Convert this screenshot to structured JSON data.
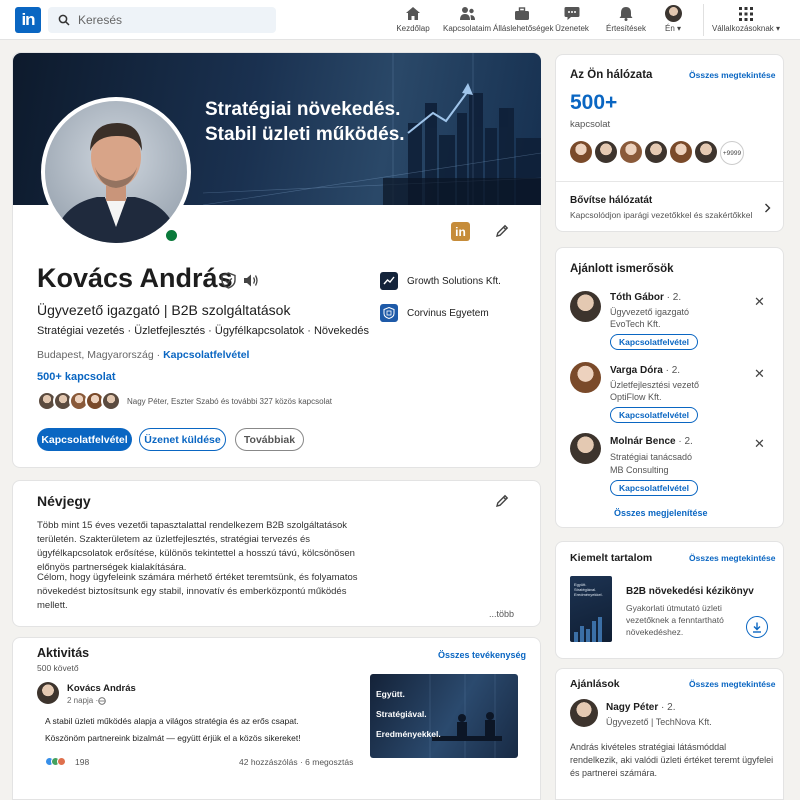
{
  "nav": {
    "search_placeholder": "Keresés",
    "items": [
      {
        "label": "Kezdőlap",
        "icon": "home-icon"
      },
      {
        "label": "Kapcsolataim",
        "icon": "network-icon"
      },
      {
        "label": "Álláslehetőségek",
        "icon": "briefcase-icon"
      },
      {
        "label": "Üzenetek",
        "icon": "message-icon"
      },
      {
        "label": "Értesítések",
        "icon": "bell-icon"
      },
      {
        "label": "Én ▾",
        "icon": "avatar"
      },
      {
        "label": "Vállalkozásoknak ▾",
        "icon": "grid-icon"
      }
    ]
  },
  "profile": {
    "banner_line1": "Stratégiai növekedés.",
    "banner_line2": "Stabil üzleti működés.",
    "name": "Kovács András",
    "headline": "Ügyvezető igazgató | B2B szolgáltatások",
    "skills": "Stratégiai vezetés · Üzletfejlesztés · Ügyfélkapcsolatok · Növekedés",
    "location": "Budapest, Magyarország",
    "contact_link": "Kapcsolatfelvétel",
    "connections": "500+ kapcsolat",
    "mutual": "Nagy Péter, Eszter Szabó és további 327 közös kapcsolat",
    "buttons": {
      "connect": "Kapcsolatfelvétel",
      "message": "Üzenet küldése",
      "more": "Továbbiak"
    },
    "orgs": [
      {
        "name": "Growth Solutions Kft."
      },
      {
        "name": "Corvinus Egyetem"
      }
    ],
    "badge_text": "in"
  },
  "about": {
    "title": "Névjegy",
    "p1": "Több mint 15 éves vezetői tapasztalattal rendelkezem B2B szolgáltatások területén. Szakterületem az üzletfejlesztés, stratégiai tervezés és ügyfélkapcsolatok erősítése, különös tekintettel a hosszú távú, kölcsönösen előnyös partnerségek kialakítására.",
    "p2": "Célom, hogy ügyfeleink számára mérhető értéket teremtsünk, és folyamatos növekedést biztosítsunk egy stabil, innovatív és emberközpontú működés mellett.",
    "more": "...több"
  },
  "activity": {
    "title": "Aktivitás",
    "followers": "500 követő",
    "all_link": "Összes tevékenység",
    "post_author": "Kovács András",
    "post_time": "2 napja · ",
    "post_line1": "A stabil üzleti működés alapja a világos stratégia és az erős csapat.",
    "post_line2": "Köszönöm partnereink bizalmát — együtt érjük el a közös sikereket!",
    "reactions": "198",
    "comments": "42 hozzászólás",
    "shares": "6 megosztás",
    "image_lines": [
      "Együtt.",
      "Stratégiával.",
      "Eredményekkel."
    ]
  },
  "network": {
    "title": "Az Ön hálózata",
    "view_all": "Összes megtekintése",
    "count": "500+",
    "label": "kapcsolat",
    "extra": "+9999",
    "expand_title": "Bővítse hálózatát",
    "expand_sub": "Kapcsolódjon iparági vezetőkkel és szakértőkkel"
  },
  "suggestions": {
    "title": "Ajánlott ismerősök",
    "items": [
      {
        "name": "Tóth Gábor",
        "degree": " · 2.",
        "role": "Ügyvezető igazgató",
        "company": "EvoTech Kft.",
        "button": "Kapcsolatfelvétel"
      },
      {
        "name": "Varga Dóra",
        "degree": " · 2.",
        "role": "Üzletfejlesztési vezető",
        "company": "OptiFlow Kft.",
        "button": "Kapcsolatfelvétel"
      },
      {
        "name": "Molnár Bence",
        "degree": " · 2.",
        "role": "Stratégiai tanácsadó",
        "company": "MB Consulting",
        "button": "Kapcsolatfelvétel"
      }
    ],
    "view_all": "Összes megjelenítése"
  },
  "featured": {
    "title": "Kiemelt tartalom",
    "view_all": "Összes megtekintése",
    "book_title": "B2B növekedési kézikönyv",
    "book_desc": "Gyakorlati útmutató üzleti vezetőknek a fenntartható növekedéshez.",
    "cover_text": "Együtt. Stratégiával. Eredményekkel."
  },
  "recommendations": {
    "title": "Ajánlások",
    "view_all": "Összes megtekintése",
    "name": "Nagy Péter",
    "degree": " · 2.",
    "role": "Ügyvezető | TechNova Kft.",
    "quote": "András kivételes stratégiai látásmóddal rendelkezik, aki valódi üzleti értéket teremt ügyfelei és partnerei számára."
  },
  "colors": {
    "brand": "#0a66c2",
    "online": "#0a7a3b"
  }
}
